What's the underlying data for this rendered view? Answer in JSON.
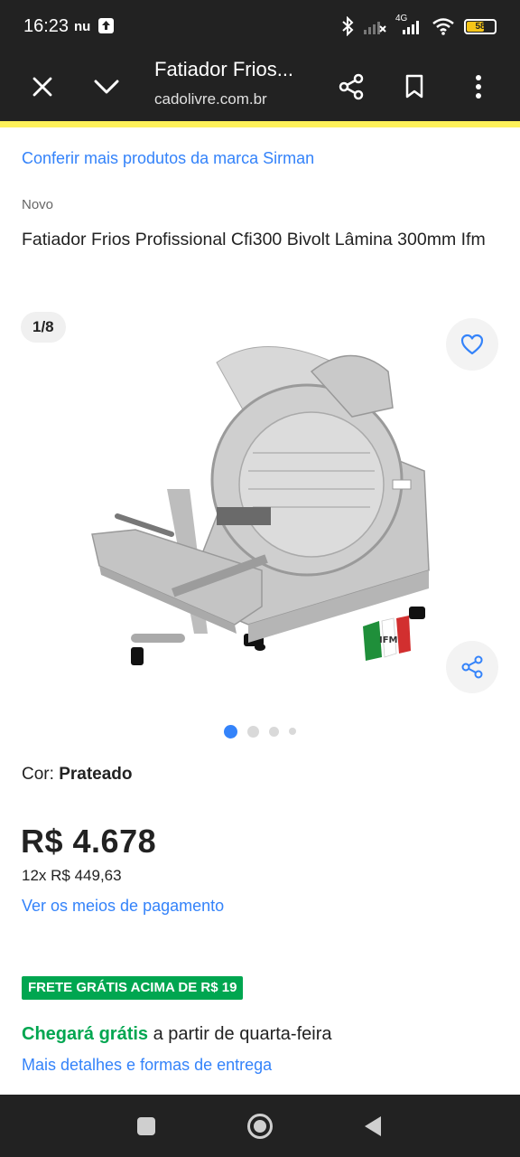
{
  "status_bar": {
    "time": "16:23",
    "carrier": "nu",
    "network": "4G",
    "battery": "58"
  },
  "toolbar": {
    "title": "Fatiador Frios...",
    "url": "cadolivre.com.br"
  },
  "product": {
    "brand_link": "Conferir mais produtos da marca Sirman",
    "condition": "Novo",
    "title": "Fatiador Frios Profissional Cfi300 Bivolt Lâmina 300mm Ifm",
    "image_counter": "1/8",
    "image_logo_text": "IFM",
    "color_label": "Cor:",
    "color_value": "Prateado",
    "price": "R$ 4.678",
    "installments": "12x R$ 449,63",
    "payment_link": "Ver os meios de pagamento",
    "carousel": {
      "total_dots": 4,
      "active_index": 0
    }
  },
  "shipping": {
    "badge": "FRETE GRÁTIS ACIMA DE R$ 19",
    "arrival_highlight": "Chegará grátis",
    "arrival_rest": " a partir de quarta-feira",
    "details_link": "Mais detalhes e formas de entrega"
  },
  "colors": {
    "link": "#3483fa",
    "accent_yellow": "#fff159",
    "shipping_green": "#00a650",
    "bar": "#222222"
  },
  "icons": [
    "close-icon",
    "chevron-down-icon",
    "share-icon",
    "bookmark-icon",
    "more-icon",
    "heart-icon",
    "nav-square-icon",
    "nav-circle-icon",
    "nav-back-icon"
  ]
}
